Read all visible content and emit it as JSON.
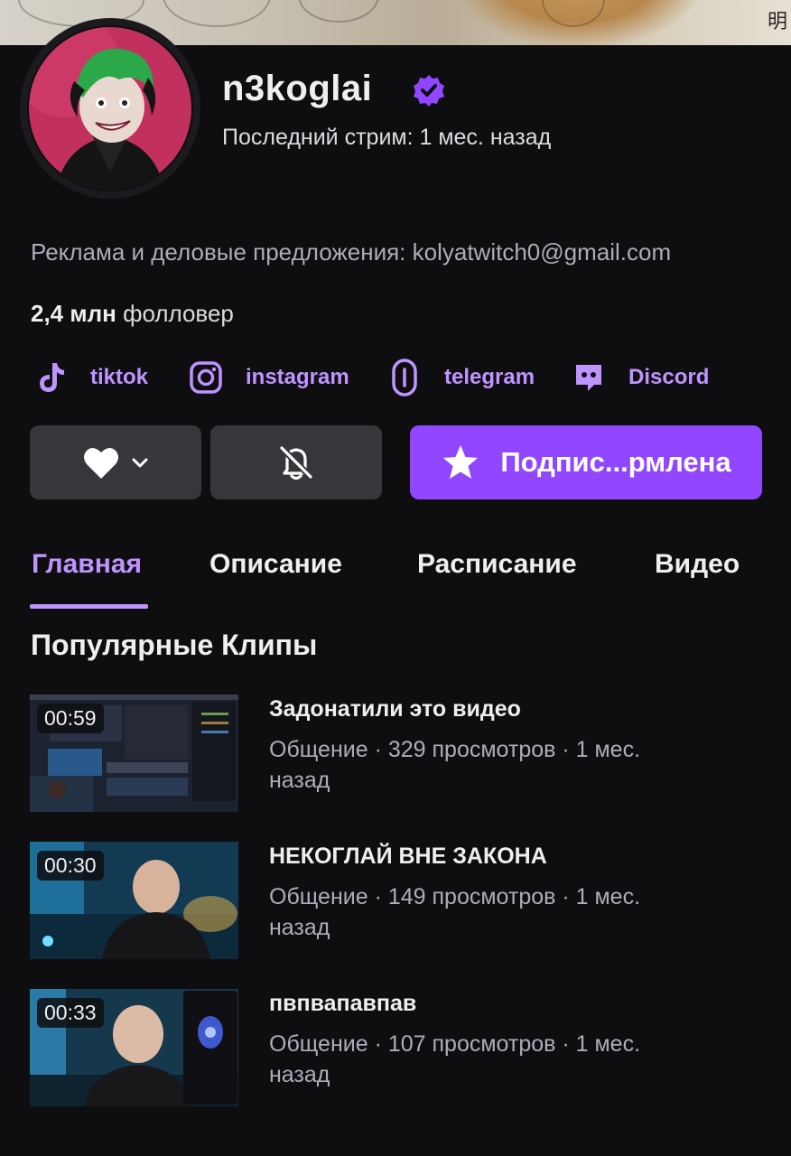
{
  "banner": {
    "glyph": "明"
  },
  "profile": {
    "name": "n3koglai",
    "last_stream": "Последний стрим: 1 мес. назад",
    "ad_text": "Реклама и деловые предложения: kolyatwitch0@gmail.com",
    "followers_count": "2,4 млн",
    "followers_label": "фолловер"
  },
  "socials": [
    {
      "label": "tiktok",
      "icon": "tiktok-icon"
    },
    {
      "label": "instagram",
      "icon": "instagram-icon"
    },
    {
      "label": "telegram",
      "icon": "link-icon"
    },
    {
      "label": "Discord",
      "icon": "discord-icon"
    }
  ],
  "actions": {
    "follow_icon": "heart-icon",
    "notify_icon": "bell-off-icon",
    "subscribe_label": "Подпис...рмлена"
  },
  "tabs": [
    {
      "label": "Главная",
      "active": true
    },
    {
      "label": "Описание",
      "active": false
    },
    {
      "label": "Расписание",
      "active": false
    },
    {
      "label": "Видео",
      "active": false
    }
  ],
  "clips_section": {
    "title": "Популярные Клипы",
    "items": [
      {
        "duration": "00:59",
        "title": "Задонатили это видео",
        "meta": "Общение · 329 просмотров · 1 мес. назад"
      },
      {
        "duration": "00:30",
        "title": "НЕКОГЛАЙ ВНЕ ЗАКОНА",
        "meta": "Общение · 149 просмотров · 1 мес. назад"
      },
      {
        "duration": "00:33",
        "title": "пвпвапавпав",
        "meta": "Общение · 107 просмотров · 1 мес. назад"
      }
    ]
  },
  "colors": {
    "accent": "#9147ff",
    "accent_text": "#bf94ff",
    "background": "#0e0e10",
    "button_bg": "#36363b"
  }
}
